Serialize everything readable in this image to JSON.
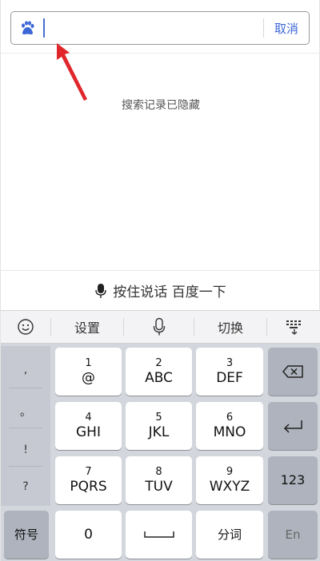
{
  "search": {
    "cancel_label": "取消",
    "value": "",
    "placeholder": ""
  },
  "history": {
    "hidden_message": "搜索记录已隐藏"
  },
  "voice": {
    "label": "按住说话 百度一下"
  },
  "keyboard": {
    "toolbar": {
      "settings_label": "设置",
      "switch_label": "切换"
    },
    "side_symbols": [
      ",",
      "。",
      "!",
      "?"
    ],
    "keys": [
      {
        "num": "1",
        "letters": "@"
      },
      {
        "num": "2",
        "letters": "ABC"
      },
      {
        "num": "3",
        "letters": "DEF"
      },
      {
        "num": "4",
        "letters": "GHI"
      },
      {
        "num": "5",
        "letters": "JKL"
      },
      {
        "num": "6",
        "letters": "MNO"
      },
      {
        "num": "7",
        "letters": "PQRS"
      },
      {
        "num": "8",
        "letters": "TUV"
      },
      {
        "num": "9",
        "letters": "WXYZ"
      }
    ],
    "bottom": {
      "symbols_label": "符号",
      "zero_label": "0",
      "segment_label": "分词",
      "num_mode_label": "123",
      "lang_label": "En"
    }
  },
  "colors": {
    "accent": "#3d67d6",
    "arrow": "#e0262b",
    "keyboard_bg": "#d3d6dd"
  }
}
